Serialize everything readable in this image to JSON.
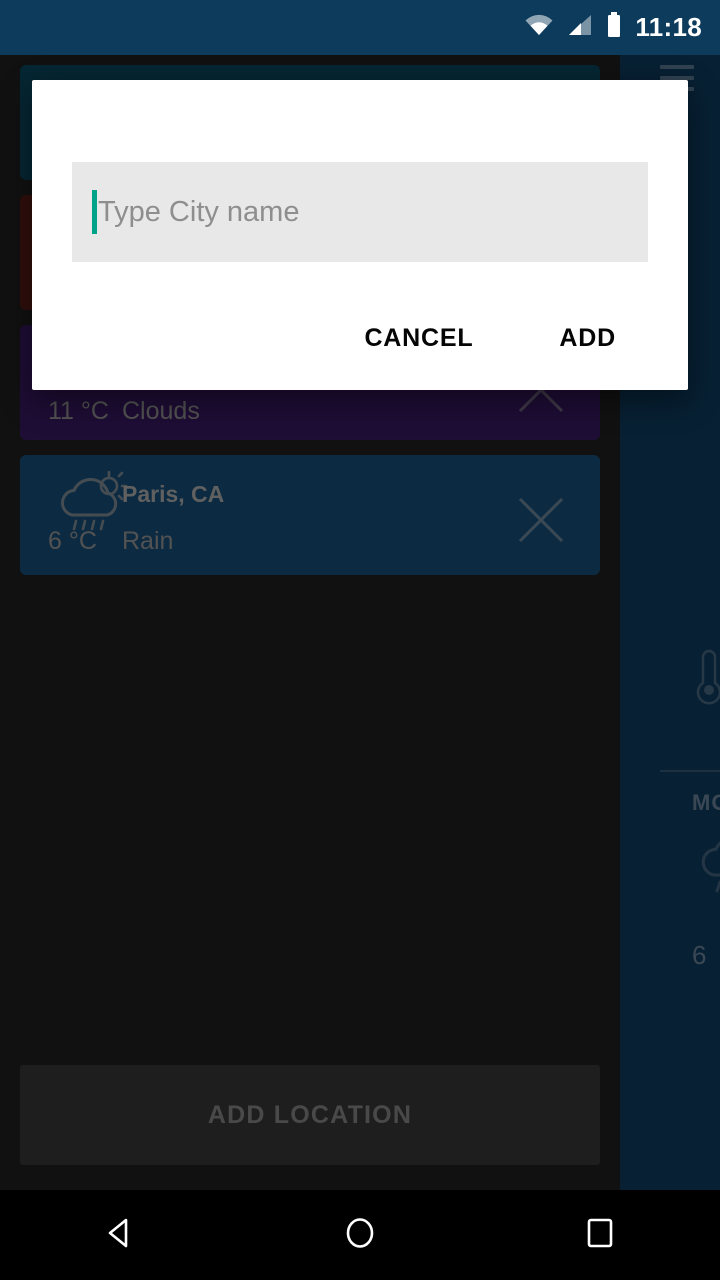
{
  "status_bar": {
    "time": "11:18",
    "icons": [
      "wifi-icon",
      "cellular-signal-icon",
      "battery-icon"
    ]
  },
  "list_screen": {
    "cards": [
      {
        "name": "",
        "description": "",
        "temperature": "",
        "color": "#0a4a63",
        "icon": "",
        "close_icon": "close-icon"
      },
      {
        "name": "",
        "description": "",
        "temperature": "",
        "color": "#5c1e18",
        "icon": "",
        "close_icon": "close-icon"
      },
      {
        "name": "",
        "description": "Clouds",
        "temperature": "11 °C",
        "color": "#3b1a66",
        "icon": "cloud-icon",
        "close_icon": "close-icon"
      },
      {
        "name": "Paris, CA",
        "description": "Rain",
        "temperature": "6 °C",
        "color": "#17537f",
        "icon": "cloud-sun-rain-icon",
        "close_icon": "close-icon"
      }
    ],
    "add_location_label": "ADD LOCATION"
  },
  "detail_panel": {
    "background_color": "#0f3e63",
    "menu_icon": "hamburger-menu-icon",
    "thermometer_icon": "thermometer-icon",
    "day_label": "MO",
    "forecast_icon": "cloud-rain-icon",
    "forecast_temperature": "6"
  },
  "dialog": {
    "title": "-",
    "input": {
      "value": "",
      "placeholder": "Type City name"
    },
    "cancel_label": "CANCEL",
    "add_label": "ADD",
    "accent_color": "#00a38a"
  },
  "nav_bar": {
    "back_icon": "back-triangle-icon",
    "home_icon": "home-circle-icon",
    "recents_icon": "recents-square-icon"
  }
}
